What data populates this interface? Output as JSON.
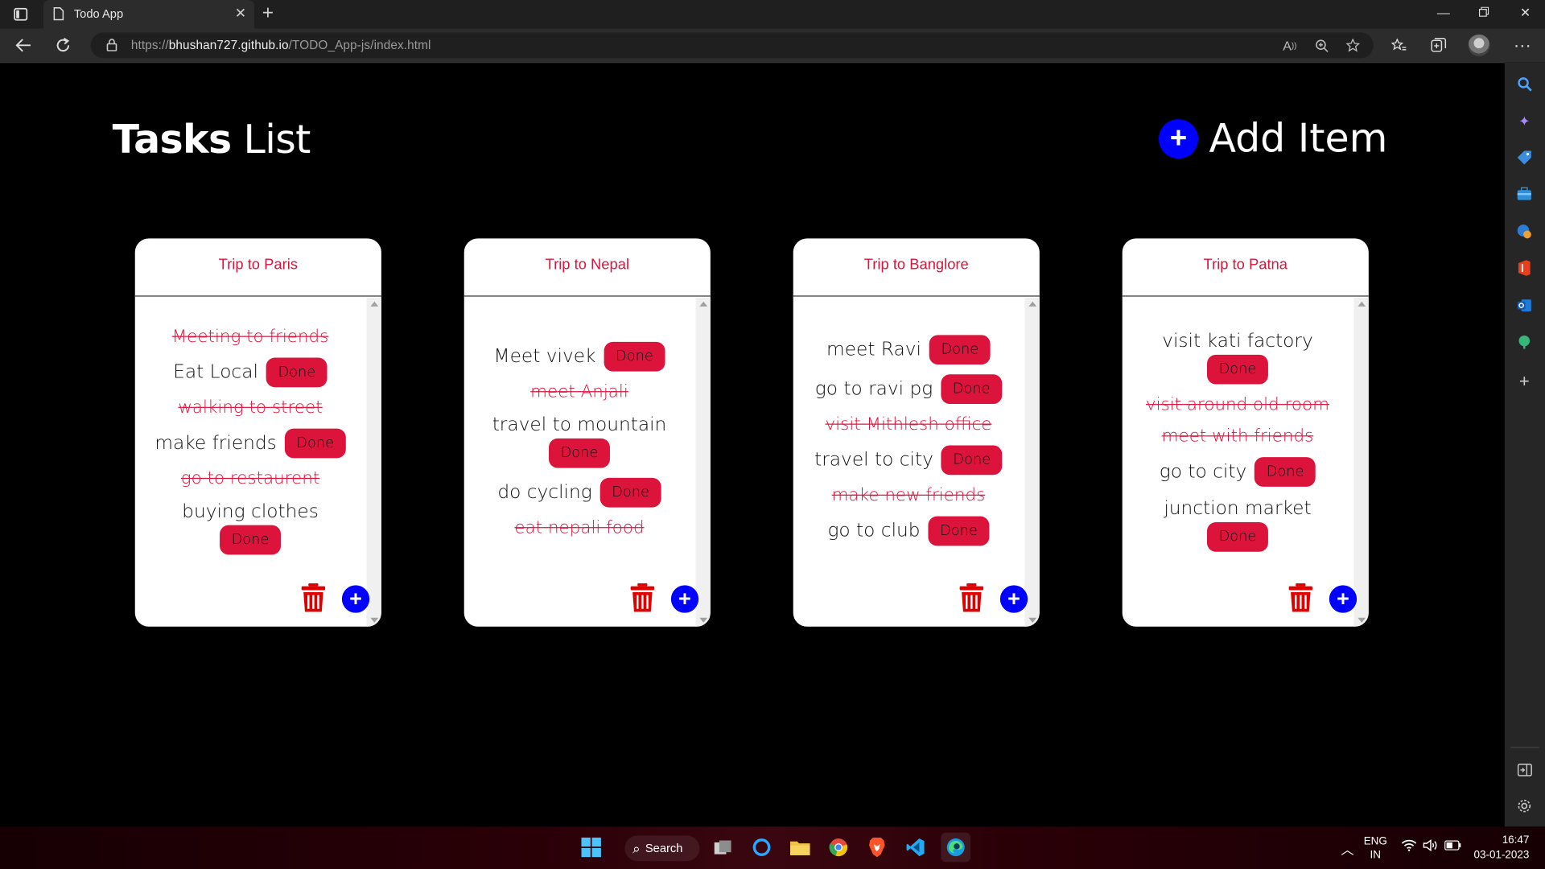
{
  "browser": {
    "tab_title": "Todo App",
    "url_prefix": "https://",
    "url_host": "bhushan727.github.io",
    "url_path": "/TODO_App-js/index.html"
  },
  "page": {
    "title_bold": "Tasks",
    "title_light": "List",
    "add_item_label": "Add Item"
  },
  "cards": [
    {
      "title": "Trip to Paris",
      "tasks": [
        {
          "text": "Meeting to friends",
          "done": true
        },
        {
          "text": "Eat Local",
          "done": false,
          "button": "Done"
        },
        {
          "text": "walking to street",
          "done": true
        },
        {
          "text": "make friends",
          "done": false,
          "button": "Done"
        },
        {
          "text": "go to restaurent",
          "done": true
        },
        {
          "text": "buying clothes",
          "done": false,
          "button": "Done"
        }
      ]
    },
    {
      "title": "Trip to Nepal",
      "tasks": [
        {
          "text": "Meet vivek",
          "done": false,
          "button": "Done"
        },
        {
          "text": "meet Anjali",
          "done": true
        },
        {
          "text": "travel to mountain",
          "done": false,
          "button": "Done"
        },
        {
          "text": "do cycling",
          "done": false,
          "button": "Done"
        },
        {
          "text": "eat nepali food",
          "done": true
        }
      ]
    },
    {
      "title": "Trip to Banglore",
      "tasks": [
        {
          "text": "meet Ravi",
          "done": false,
          "button": "Done"
        },
        {
          "text": "go to ravi pg",
          "done": false,
          "button": "Done"
        },
        {
          "text": "visit Mithlesh office",
          "done": true
        },
        {
          "text": "travel to city",
          "done": false,
          "button": "Done"
        },
        {
          "text": "make new friends",
          "done": true
        },
        {
          "text": "go to club",
          "done": false,
          "button": "Done"
        }
      ]
    },
    {
      "title": "Trip to Patna",
      "tasks": [
        {
          "text": "visit kati factory",
          "done": false,
          "button": "Done"
        },
        {
          "text": "visit around old room",
          "done": true
        },
        {
          "text": "meet with friends",
          "done": true
        },
        {
          "text": "go to city",
          "done": false,
          "button": "Done"
        },
        {
          "text": "junction market",
          "done": false,
          "button": "Done"
        }
      ]
    }
  ],
  "taskbar": {
    "search_label": "Search",
    "lang_line1": "ENG",
    "lang_line2": "IN",
    "time": "16:47",
    "date": "03-01-2023"
  },
  "colors": {
    "accent_red": "#dc143c",
    "accent_blue": "#0000ff",
    "background": "#000000"
  }
}
